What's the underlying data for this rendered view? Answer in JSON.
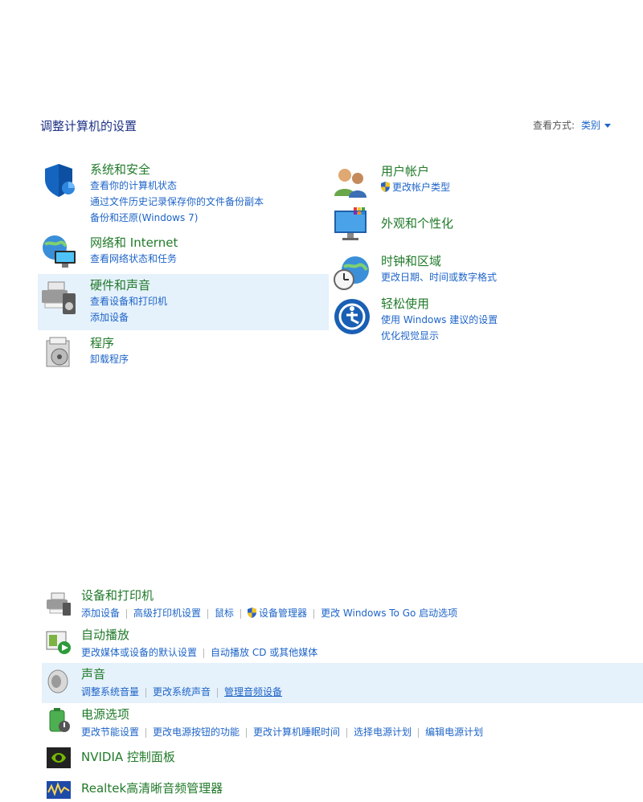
{
  "header": {
    "title": "调整计算机的设置",
    "view_by_label": "查看方式:",
    "view_by_value": "类别"
  },
  "categories": {
    "system": {
      "title": "系统和安全",
      "links": [
        "查看你的计算机状态",
        "通过文件历史记录保存你的文件备份副本",
        "备份和还原(Windows 7)"
      ]
    },
    "network": {
      "title": "网络和 Internet",
      "links": [
        "查看网络状态和任务"
      ]
    },
    "hardware": {
      "title": "硬件和声音",
      "links": [
        "查看设备和打印机",
        "添加设备"
      ]
    },
    "programs": {
      "title": "程序",
      "links": [
        "卸载程序"
      ]
    },
    "user": {
      "title": "用户帐户",
      "links": [
        "更改帐户类型"
      ]
    },
    "appearance": {
      "title": "外观和个性化",
      "links": []
    },
    "clock": {
      "title": "时钟和区域",
      "links": [
        "更改日期、时间或数字格式"
      ]
    },
    "ease": {
      "title": "轻松使用",
      "links": [
        "使用 Windows 建议的设置",
        "优化视觉显示"
      ]
    }
  },
  "items": {
    "devices": {
      "title": "设备和打印机",
      "links": [
        "添加设备",
        "高级打印机设置",
        "鼠标",
        "设备管理器",
        "更改 Windows To Go 启动选项"
      ]
    },
    "autoplay": {
      "title": "自动播放",
      "links": [
        "更改媒体或设备的默认设置",
        "自动播放 CD 或其他媒体"
      ]
    },
    "sound": {
      "title": "声音",
      "links": [
        "调整系统音量",
        "更改系统声音",
        "管理音频设备"
      ]
    },
    "power": {
      "title": "电源选项",
      "links": [
        "更改节能设置",
        "更改电源按钮的功能",
        "更改计算机睡眠时间",
        "选择电源计划",
        "编辑电源计划"
      ]
    },
    "nvidia": {
      "title": "NVIDIA 控制面板"
    },
    "realtek": {
      "title": "Realtek高清晰音频管理器"
    }
  },
  "colors": {
    "title_green": "#217a2a",
    "link_blue": "#1e64c8",
    "highlight": "#e5f1fb"
  }
}
